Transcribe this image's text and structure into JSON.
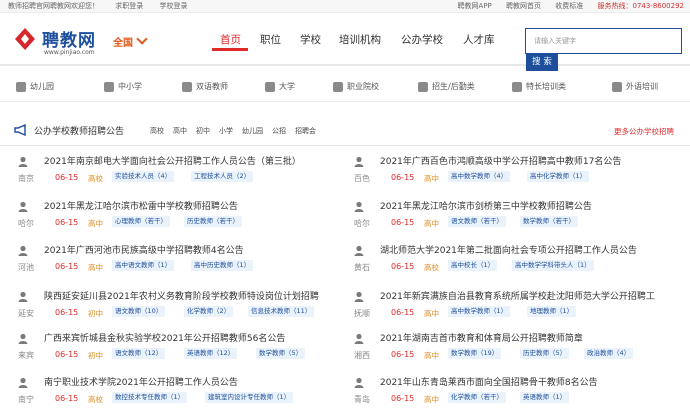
{
  "topbar": {
    "welcome": "教师招聘官网聘教网欢迎您！",
    "login": "求职登录",
    "school_login": "学校登录",
    "app": "聘教网APP",
    "home": "聘教网首页",
    "fees": "收费标准",
    "phone": "服务热线：0743-8600292"
  },
  "header": {
    "logo": "聘教网",
    "url": "www.pinjiao.com",
    "city": "全国",
    "search_placeholder": "请输入关键字",
    "search_button": "搜 索"
  },
  "nav": [
    "首页",
    "职位",
    "学校",
    "培训机构",
    "公办学校",
    "人才库"
  ],
  "categories": [
    {
      "label": "幼儿园",
      "icon": "kindergarten-icon"
    },
    {
      "label": "中小学",
      "icon": "school-icon"
    },
    {
      "label": "双语教师",
      "icon": "bilingual-icon"
    },
    {
      "label": "大学",
      "icon": "university-icon"
    },
    {
      "label": "职业院校",
      "icon": "vocational-icon"
    },
    {
      "label": "招生/后勤类",
      "icon": "admissions-icon"
    },
    {
      "label": "特长培训类",
      "icon": "training-icon"
    },
    {
      "label": "外语培训",
      "icon": "language-icon"
    }
  ],
  "section": {
    "title": "公办学校教师招聘公告",
    "tags": [
      "高校",
      "高中",
      "初中",
      "小学",
      "幼儿园",
      "公招",
      "招聘会"
    ],
    "more": "更多公办学校招聘"
  },
  "items": [
    {
      "title": "2021年南京邮电大学面向社会公开招聘工作人员公告（第三批）",
      "city": "南京",
      "date": "06-15",
      "level": "高校",
      "tags": [
        "实验技术人员（4）",
        "工程技术人员（2）"
      ]
    },
    {
      "title": "2021年广西百色市鸿顺高级中学公开招聘高中教师17名公告",
      "city": "百色",
      "date": "06-15",
      "level": "高中",
      "tags": [
        "高中数学教师（4）",
        "高中化学教师（1）"
      ]
    },
    {
      "title": "2021年黑龙江哈尔滨市松雷中学校教师招聘公告",
      "city": "哈尔",
      "date": "06-15",
      "level": "高中",
      "tags": [
        "心理教师（若干）",
        "历史教师（若干）"
      ]
    },
    {
      "title": "2021年黑龙江哈尔滨市剑桥第三中学校教师招聘公告",
      "city": "哈尔",
      "date": "06-15",
      "level": "高中",
      "tags": [
        "语文教师（若干）",
        "数学教师（若干）"
      ]
    },
    {
      "title": "2021年广西河池市民族高级中学招聘教师4名公告",
      "city": "河池",
      "date": "06-15",
      "level": "高中",
      "tags": [
        "高中语文教师（1）",
        "高中历史教师（1）"
      ]
    },
    {
      "title": "湖北师范大学2021年第二批面向社会专项公开招聘工作人员公告",
      "city": "黄石",
      "date": "06-15",
      "level": "高校",
      "tags": [
        "高中校长（1）",
        "高中数学学科带头人（1）"
      ]
    },
    {
      "title": "陕西延安延川县2021年农村义务教育阶段学校教师特设岗位计划招聘",
      "city": "延安",
      "date": "06-15",
      "level": "初中",
      "tags": [
        "语文教师（10）",
        "化学教师（2）",
        "信息技术教师（11）"
      ]
    },
    {
      "title": "2021年新宾满族自治县教育系统所属学校赴沈阳师范大学公开招聘工",
      "city": "抚顺",
      "date": "06-15",
      "level": "高中",
      "tags": [
        "高中数学教师（1）",
        "地理教师（1）"
      ]
    },
    {
      "title": "广西来宾忻城县金秋实验学校2021年公开招聘教师56名公告",
      "city": "来宾",
      "date": "06-15",
      "level": "初中",
      "tags": [
        "语文教师（12）",
        "英语教师（12）",
        "数学教师（5）"
      ]
    },
    {
      "title": "2021年湖南吉首市教育和体育局公开招聘教师简章",
      "city": "湘西",
      "date": "06-15",
      "level": "高中",
      "tags": [
        "数学教师（19）",
        "历史教师（5）",
        "政治教师（4）"
      ]
    },
    {
      "title": "南宁职业技术学院2021年公开招聘工作人员公告",
      "city": "南宁",
      "date": "06-15",
      "level": "高校",
      "tags": [
        "数控技术专任教师（1）",
        "建筑室内设计专任教师（1）"
      ]
    },
    {
      "title": "2021年山东青岛莱西市面向全国招聘骨干教师8名公告",
      "city": "青岛",
      "date": "06-15",
      "level": "高中",
      "tags": [
        "化学教师（若干）",
        "英语教师（1）"
      ]
    }
  ]
}
